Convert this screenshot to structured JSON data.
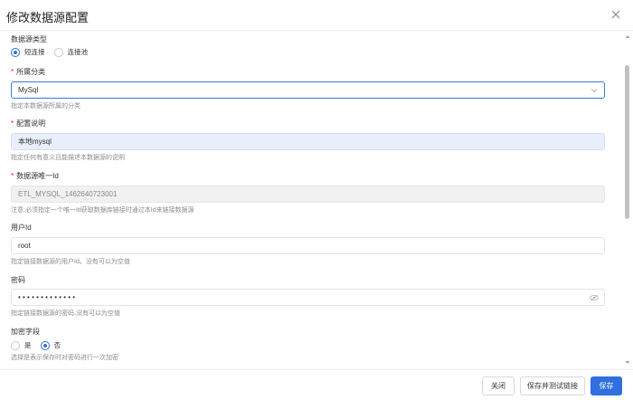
{
  "dialog": {
    "title": "修改数据源配置"
  },
  "form": {
    "source_type": {
      "label": "数据源类型",
      "options": [
        "短连接",
        "连接池"
      ],
      "selected": "短连接"
    },
    "category": {
      "label": "所属分类",
      "required": true,
      "value": "MySql",
      "hint": "指定本数据源所属的分类"
    },
    "description": {
      "label": "配置说明",
      "required": true,
      "value": "本地mysql",
      "hint": "指定任何有意义且能描述本数据源的说明"
    },
    "unique_id": {
      "label": "数据源唯一Id",
      "required": true,
      "value": "ETL_MYSQL_1462640723001",
      "hint": "注意:必须指定一个唯一Id获取数据库链接时通过本Id来链接数据源"
    },
    "user_id": {
      "label": "用户Id",
      "value": "root",
      "hint": "指定链接数据源的用户Id。没有可以为空值"
    },
    "password": {
      "label": "密码",
      "value": "• • • • • • • • • • • • •",
      "hint": "指定链接数据源的密码,没有可以为空值"
    },
    "encrypt": {
      "label": "加密字段",
      "options": [
        "是",
        "否"
      ],
      "selected": "否",
      "hint": "选择是表示保存时对密码进行一次加密"
    }
  },
  "footer": {
    "close_label": "关闭",
    "save_test_label": "保存并测试链接",
    "save_label": "保存"
  },
  "colors": {
    "primary": "#2f6fde",
    "required": "#e02020"
  }
}
